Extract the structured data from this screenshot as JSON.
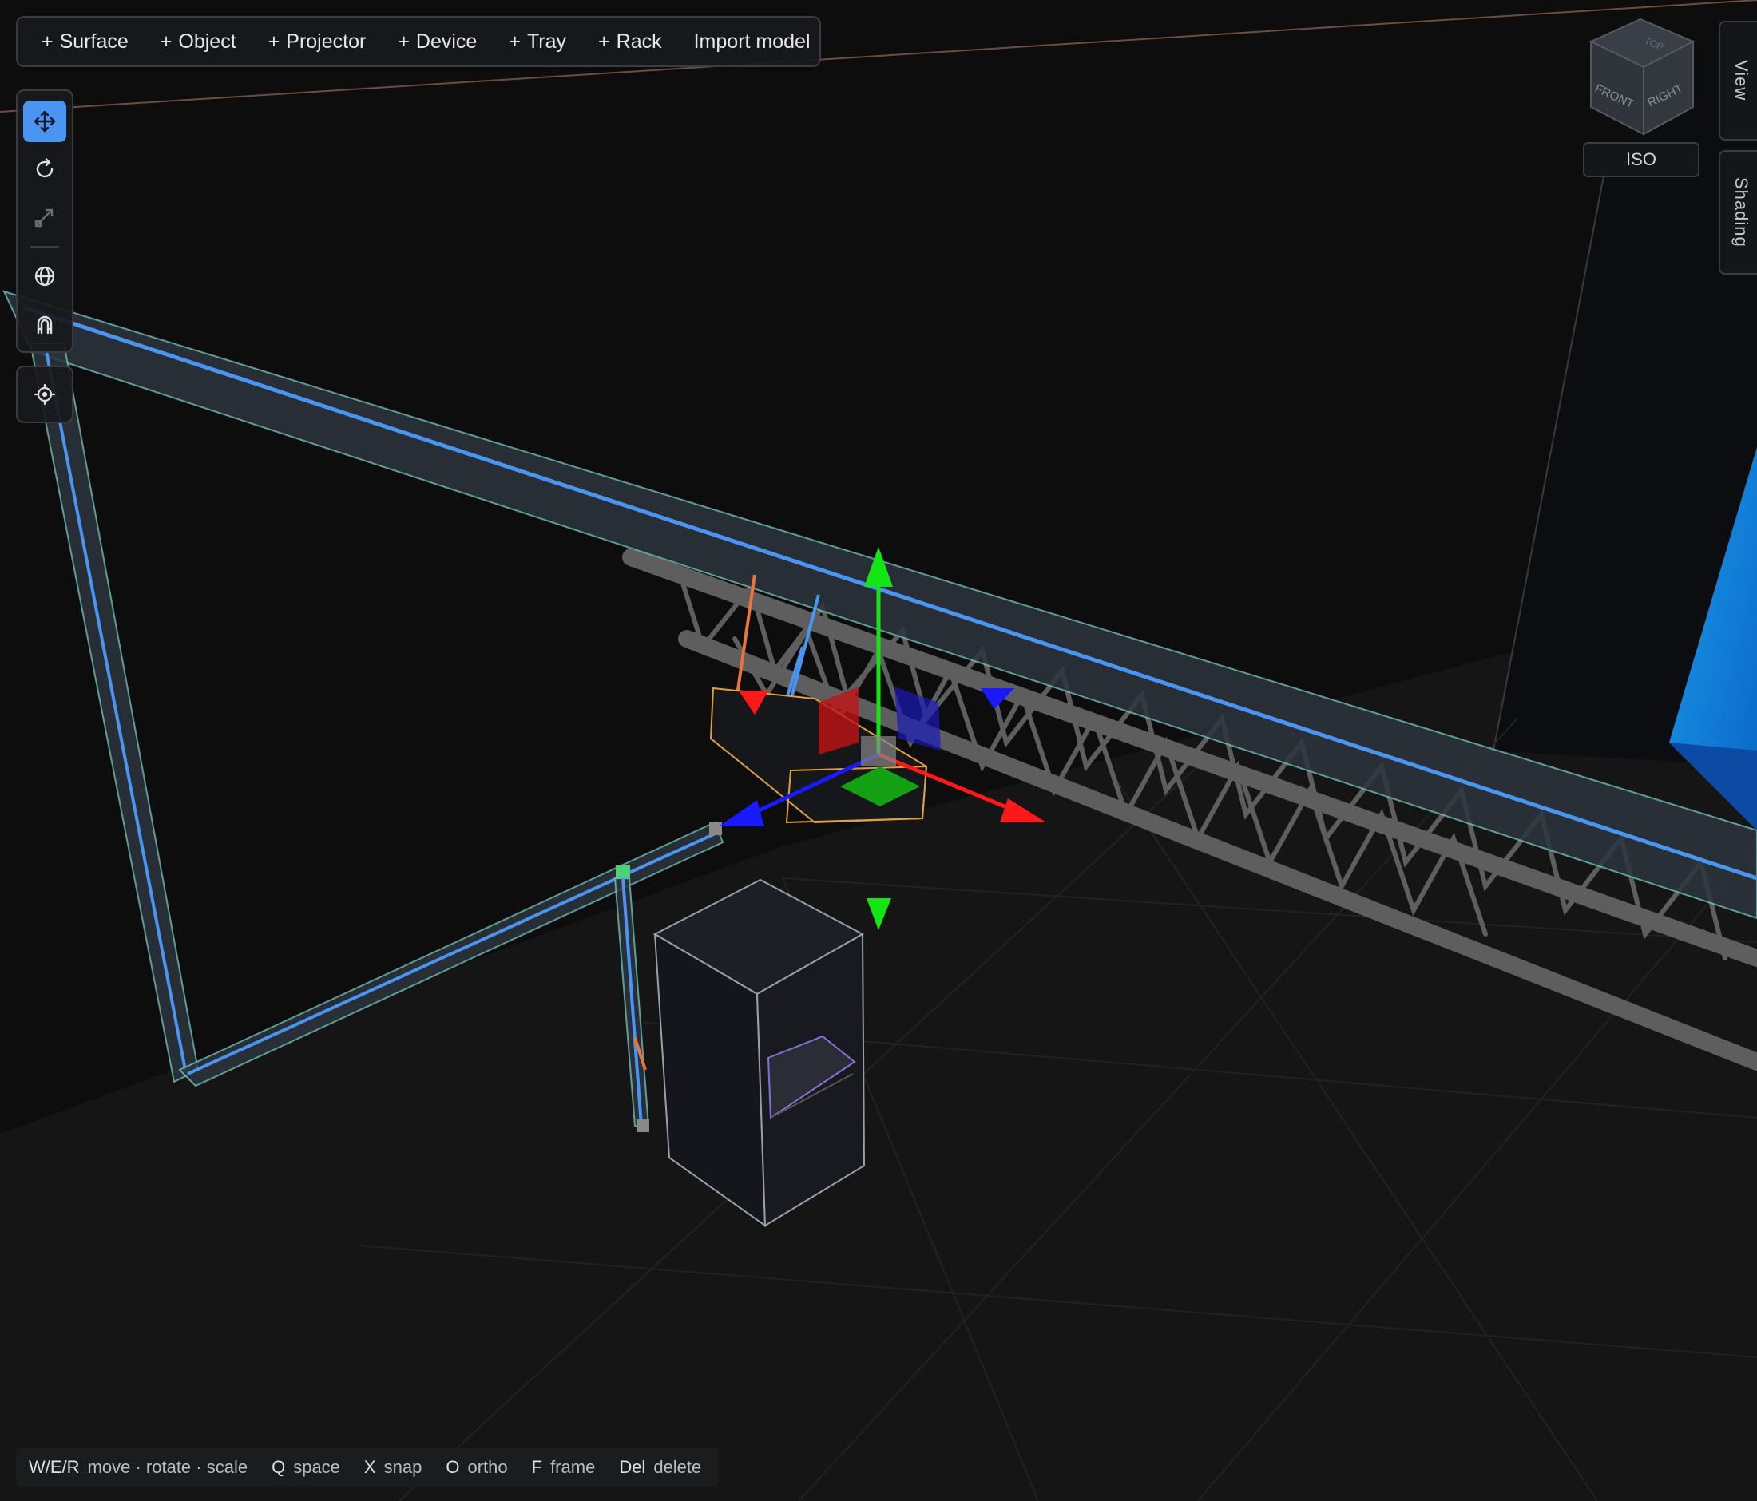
{
  "toolbar": {
    "buttons": [
      {
        "plus": "+",
        "label": "Surface"
      },
      {
        "plus": "+",
        "label": "Object"
      },
      {
        "plus": "+",
        "label": "Projector"
      },
      {
        "plus": "+",
        "label": "Device"
      },
      {
        "plus": "+",
        "label": "Tray"
      },
      {
        "plus": "+",
        "label": "Rack"
      },
      {
        "plus": "",
        "label": "Import model"
      }
    ]
  },
  "tools": {
    "active": "move",
    "items": [
      "move-icon",
      "rotate-icon",
      "scale-icon",
      "globe-icon",
      "magnet-icon",
      "crosshair-icon"
    ]
  },
  "view_cube": {
    "faces": {
      "top": "TOP",
      "front": "FRONT",
      "right": "RIGHT"
    },
    "iso_label": "ISO"
  },
  "side_tabs": {
    "view": "View",
    "shading": "Shading"
  },
  "shortcuts": [
    {
      "key": "W/E/R",
      "desc": "move · rotate · scale"
    },
    {
      "key": "Q",
      "desc": "space"
    },
    {
      "key": "X",
      "desc": "snap"
    },
    {
      "key": "O",
      "desc": "ortho"
    },
    {
      "key": "F",
      "desc": "frame"
    },
    {
      "key": "Del",
      "desc": "delete"
    }
  ],
  "colors": {
    "accent": "#4b95f2",
    "gizmo_x": "#ff1a1a",
    "gizmo_y": "#14e614",
    "gizmo_z": "#1a1aff",
    "tray_line": "#4b95f2",
    "truss": "#5e5e5e",
    "selection": "#e0a040",
    "cable_orange": "#e8753a"
  }
}
